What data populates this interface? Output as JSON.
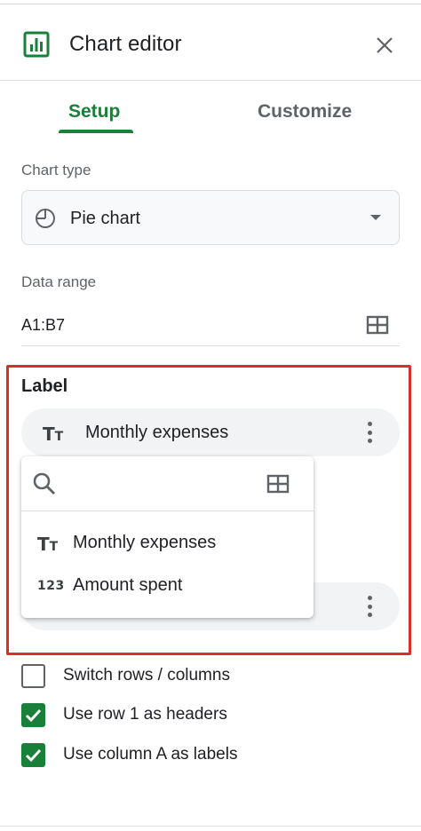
{
  "header": {
    "title": "Chart editor",
    "icon": "chart-icon",
    "close_icon": "close-icon"
  },
  "tabs": [
    {
      "label": "Setup",
      "active": true
    },
    {
      "label": "Customize",
      "active": false
    }
  ],
  "chart_type": {
    "label": "Chart type",
    "value": "Pie chart",
    "icon": "pie-chart-icon"
  },
  "data_range": {
    "label": "Data range",
    "value": "A1:B7",
    "icon": "grid-select-icon"
  },
  "label_section": {
    "heading": "Label",
    "selected_value": "Monthly expenses",
    "selected_icon": "text-type-icon"
  },
  "popup": {
    "search_placeholder": "",
    "items": [
      {
        "label": "Monthly expenses",
        "icon": "text-type-icon"
      },
      {
        "label": "Amount spent",
        "icon": "number-type-icon"
      }
    ]
  },
  "options": [
    {
      "label": "Switch rows / columns",
      "checked": false
    },
    {
      "label": "Use row 1 as headers",
      "checked": true
    },
    {
      "label": "Use column A as labels",
      "checked": true
    }
  ],
  "colors": {
    "accent_green": "#188038",
    "highlight_red": "#d93025",
    "chip_bg": "#f1f3f4"
  }
}
